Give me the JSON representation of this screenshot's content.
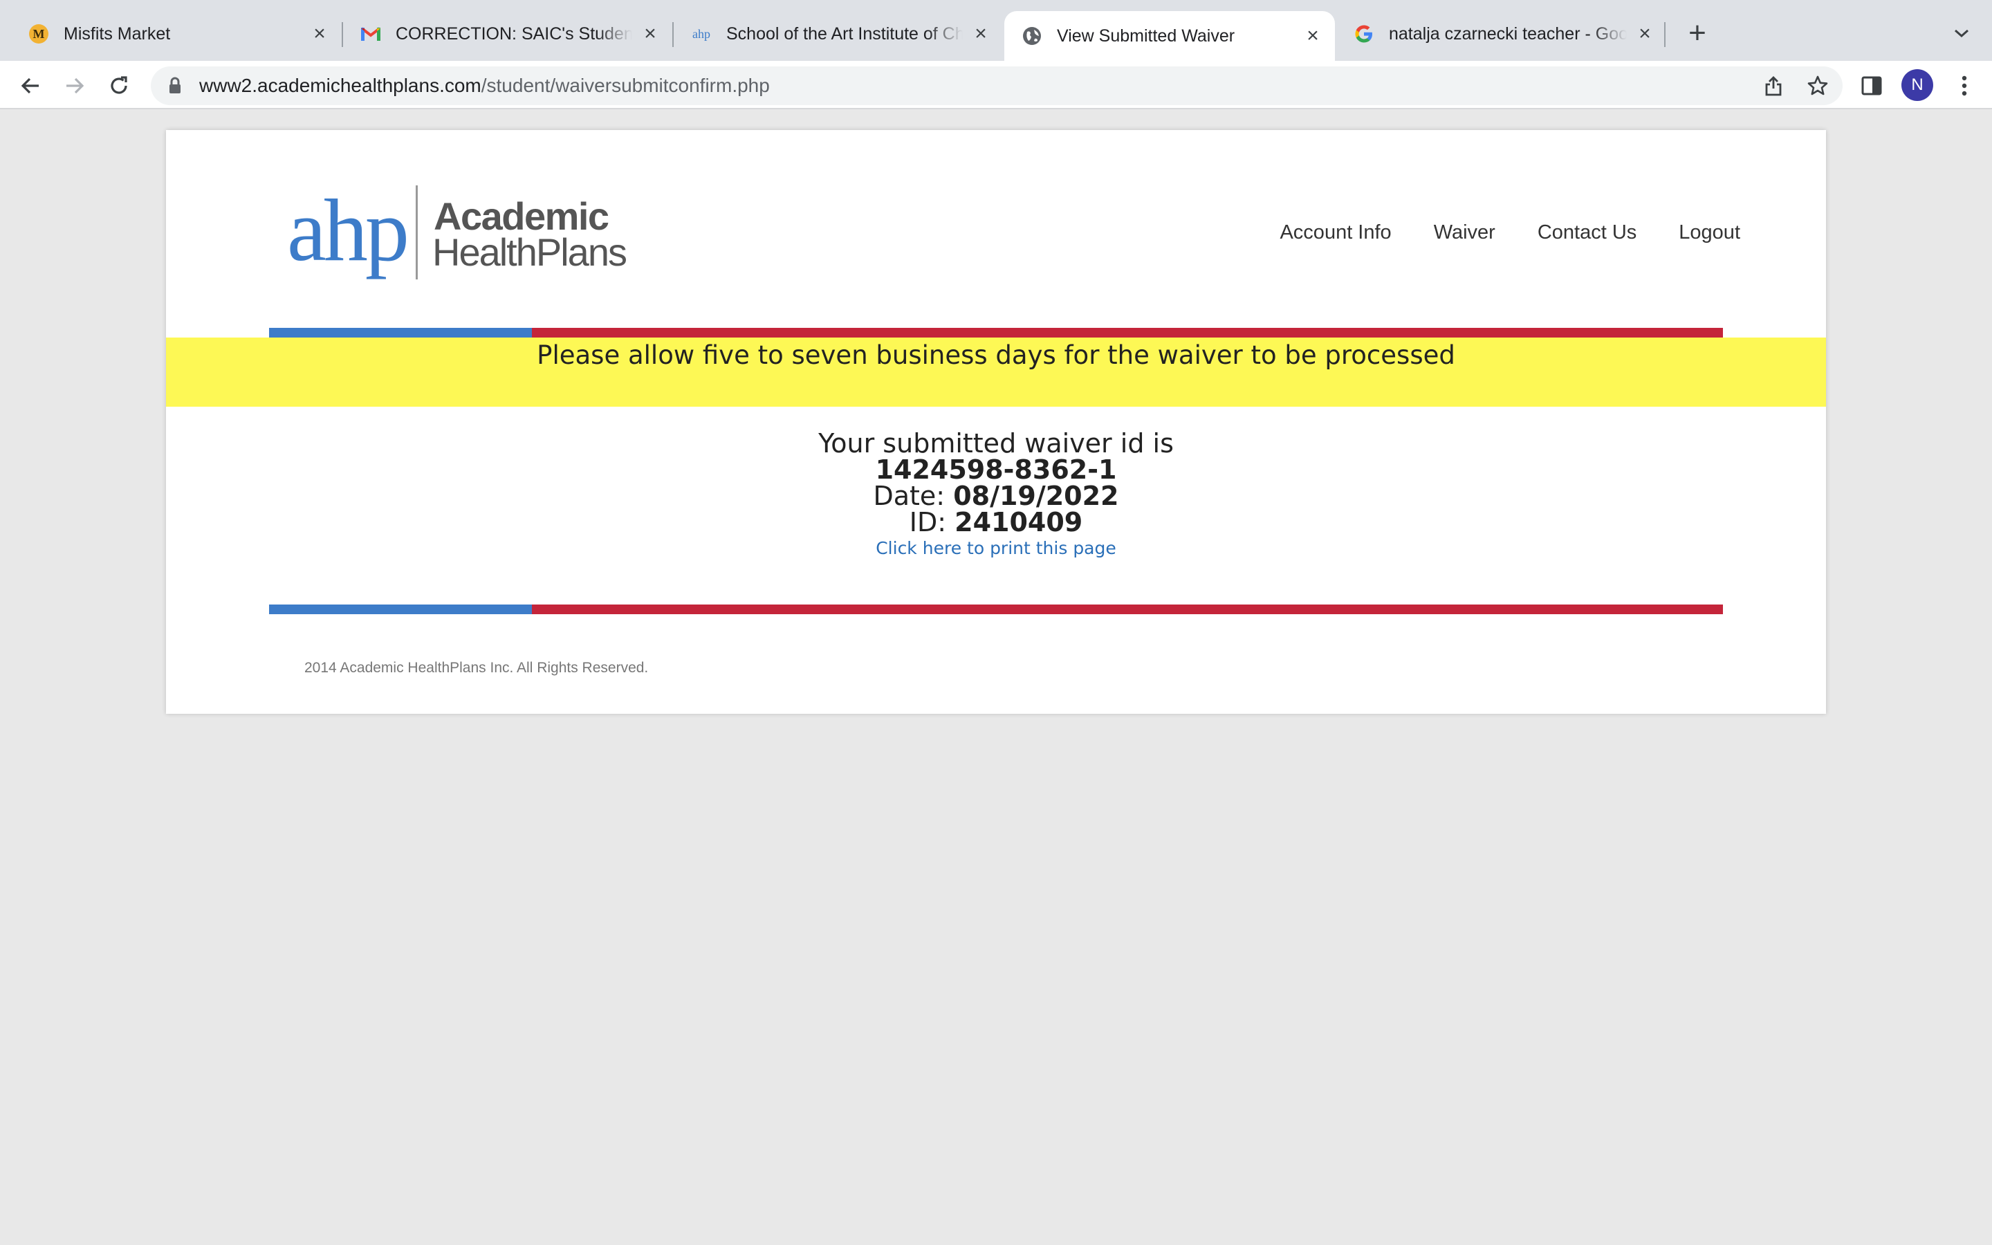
{
  "browser": {
    "tabs": [
      {
        "title": "Misfits Market",
        "favicon": "misfits-market-icon",
        "active": false
      },
      {
        "title": "CORRECTION: SAIC's Student Health Insurance",
        "favicon": "gmail-icon",
        "active": false
      },
      {
        "title": "School of the Art Institute of Chicago",
        "favicon": "ahp-icon",
        "favicon_text": "ahp",
        "active": false
      },
      {
        "title": "View Submitted Waiver",
        "favicon": "globe-icon",
        "active": true
      },
      {
        "title": "natalja czarnecki teacher - Google Search",
        "favicon": "google-icon",
        "active": false
      }
    ],
    "new_tab_label": "+",
    "url": {
      "host": "www2.academichealthplans.com",
      "path": "/student/waiversubmitconfirm.php"
    },
    "profile_initial": "N",
    "colors": {
      "tabstrip": "#dee1e6",
      "avatar": "#3c3aa7"
    }
  },
  "header": {
    "logo": {
      "mark": "ahp",
      "line1": "Academic",
      "line2": "HealthPlans",
      "mark_color": "#3d7cc9",
      "text_color": "#555555"
    },
    "nav": [
      "Account Info",
      "Waiver",
      "Contact Us",
      "Logout"
    ]
  },
  "notice": {
    "text": "Please allow five to seven business days for the waiver to be processed",
    "background": "#fdf855"
  },
  "confirmation": {
    "intro": "Your submitted waiver id is",
    "waiver_id": "1424598-8362-1",
    "date_label": "Date:",
    "date": "08/19/2022",
    "id_label": "ID:",
    "id": "2410409",
    "print_link": "Click here to print this page"
  },
  "stripe_colors": {
    "blue": "#3d7cc9",
    "red": "#c4253a"
  },
  "footer": {
    "copyright": "2014 Academic HealthPlans Inc. All Rights Reserved."
  }
}
